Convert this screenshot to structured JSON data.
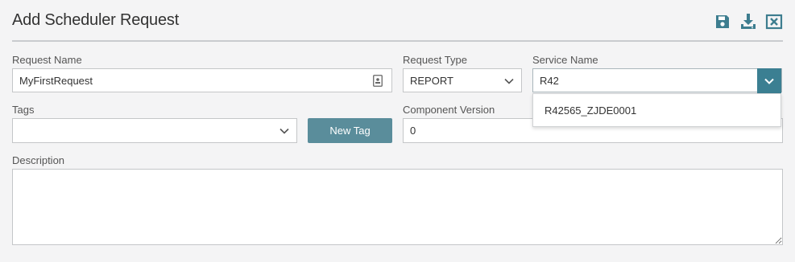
{
  "header": {
    "title": "Add Scheduler Request",
    "icons": [
      "save-icon",
      "download-icon",
      "close-icon"
    ]
  },
  "form": {
    "request_name": {
      "label": "Request Name",
      "value": "MyFirstRequest"
    },
    "request_type": {
      "label": "Request Type",
      "value": "REPORT"
    },
    "service_name": {
      "label": "Service Name",
      "value": "R42",
      "options": [
        "R42565_ZJDE0001"
      ]
    },
    "tags": {
      "label": "Tags",
      "value": ""
    },
    "new_tag_button": "New Tag",
    "component_version": {
      "label": "Component Version",
      "value": "0"
    },
    "description": {
      "label": "Description",
      "value": ""
    }
  },
  "colors": {
    "accent": "#3b7f92",
    "button": "#5a8d9b",
    "icon": "#3d7d8f"
  }
}
